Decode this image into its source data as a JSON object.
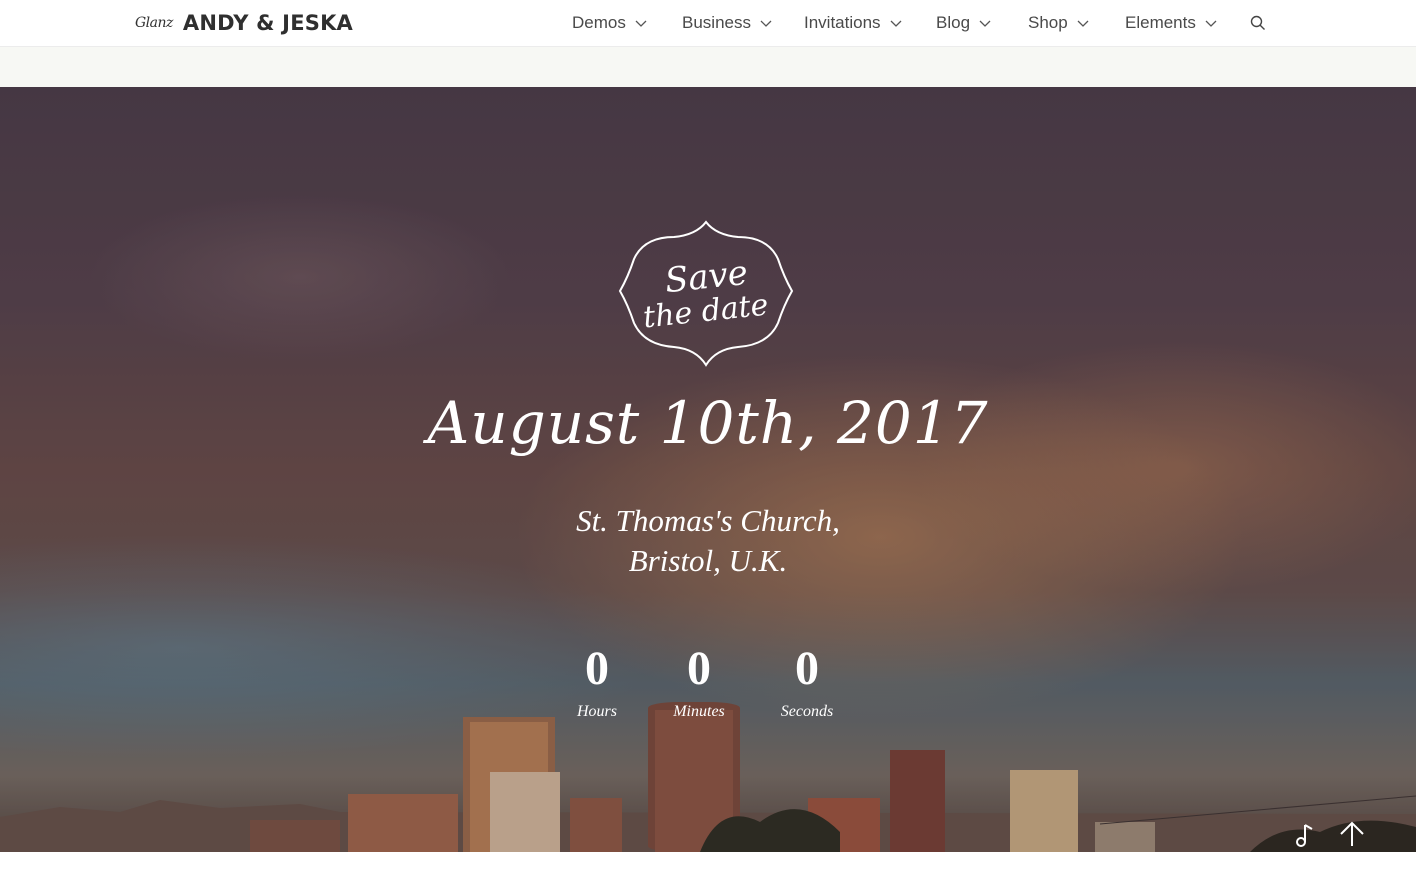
{
  "header": {
    "logo_script": "Glanz",
    "logo_name": "ANDY & JESKA",
    "nav": [
      {
        "label": "Demos",
        "icon": "chevron-down-icon"
      },
      {
        "label": "Business",
        "icon": "chevron-down-icon"
      },
      {
        "label": "Invitations",
        "icon": "chevron-down-icon"
      },
      {
        "label": "Blog",
        "icon": "chevron-down-icon"
      },
      {
        "label": "Shop",
        "icon": "chevron-down-icon"
      },
      {
        "label": "Elements",
        "icon": "chevron-down-icon"
      }
    ],
    "search_icon": "search-icon"
  },
  "hero": {
    "badge": {
      "line1": "Save",
      "line2": "the date"
    },
    "date": "August 10th, 2017",
    "venue_line1": "St. Thomas's Church,",
    "venue_line2": "Bristol, U.K.",
    "countdown": [
      {
        "value": "0",
        "label": "Hours"
      },
      {
        "value": "0",
        "label": "Minutes"
      },
      {
        "value": "0",
        "label": "Seconds"
      }
    ],
    "music_icon": "music-note-icon",
    "back_to_top_icon": "arrow-up-icon"
  },
  "colors": {
    "text_dark": "#2f2f2f",
    "nav_text": "#4a4a4a",
    "band": "#f7f8f4",
    "hero_text": "#ffffff"
  }
}
